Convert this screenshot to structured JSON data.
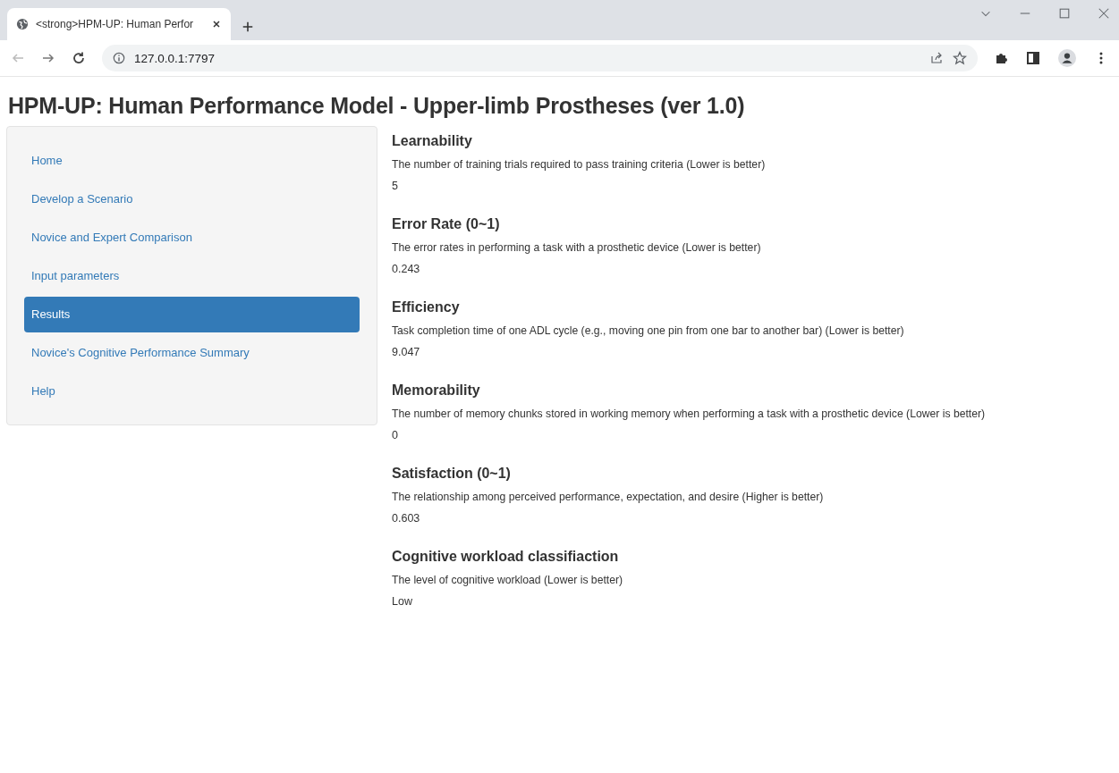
{
  "browser": {
    "tab_title": "<strong>HPM-UP: Human Perfor",
    "url": "127.0.0.1:7797"
  },
  "page_title": "HPM-UP: Human Performance Model - Upper-limb Prostheses (ver 1.0)",
  "sidebar": {
    "items": [
      {
        "label": "Home",
        "selected": false
      },
      {
        "label": "Develop a Scenario",
        "selected": false
      },
      {
        "label": "Novice and Expert Comparison",
        "selected": false
      },
      {
        "label": "Input parameters",
        "selected": false
      },
      {
        "label": "Results",
        "selected": true
      },
      {
        "label": "Novice's Cognitive Performance Summary",
        "selected": false
      },
      {
        "label": "Help",
        "selected": false
      }
    ]
  },
  "results": [
    {
      "heading": "Learnability",
      "description": "The number of training trials required to pass training criteria (Lower is better)",
      "value": "5"
    },
    {
      "heading": "Error Rate (0~1)",
      "description": "The error rates in performing a task with a prosthetic device (Lower is better)",
      "value": "0.243"
    },
    {
      "heading": "Efficiency",
      "description": "Task completion time of one ADL cycle (e.g., moving one pin from one bar to another bar) (Lower is better)",
      "value": "9.047"
    },
    {
      "heading": "Memorability",
      "description": "The number of memory chunks stored in working memory when performing a task with a prosthetic device (Lower is better)",
      "value": "0"
    },
    {
      "heading": "Satisfaction (0~1)",
      "description": "The relationship among perceived performance, expectation, and desire (Higher is better)",
      "value": "0.603"
    },
    {
      "heading": "Cognitive workload classifiaction",
      "description": "The level of cognitive workload (Lower is better)",
      "value": "Low"
    }
  ]
}
